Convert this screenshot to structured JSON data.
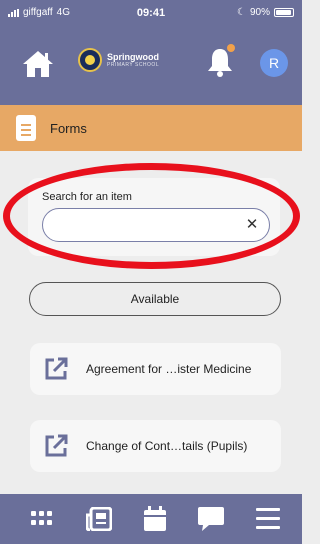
{
  "status_bar": {
    "carrier": "giffgaff",
    "network": "4G",
    "time": "09:41",
    "battery": "90%",
    "battery_level": 0.9
  },
  "header": {
    "logo_text": "Springwood",
    "logo_subtext": "PRIMARY SCHOOL",
    "avatar_initial": "R",
    "icons": [
      "home-icon",
      "bell-icon"
    ],
    "notification_dot_color": "#f2a14a"
  },
  "section": {
    "title": "Forms",
    "icon": "document-icon",
    "color": "#e7a865"
  },
  "search": {
    "label": "Search for an item",
    "value": "",
    "placeholder": "",
    "clear_label": "✕"
  },
  "filter": {
    "label": "Available"
  },
  "forms": [
    {
      "title": "Agreement for …ister Medicine",
      "icon": "external-link-icon"
    },
    {
      "title": "Change of Cont…tails (Pupils)",
      "icon": "external-link-icon"
    }
  ],
  "bottom_nav": {
    "items": [
      "grid-icon",
      "news-icon",
      "calendar-icon",
      "chat-icon",
      "menu-icon"
    ]
  },
  "colors": {
    "primary": "#6a6f9a",
    "accent": "#e7a865",
    "highlight_oval": "#e8101c",
    "avatar": "#6b96e8"
  }
}
